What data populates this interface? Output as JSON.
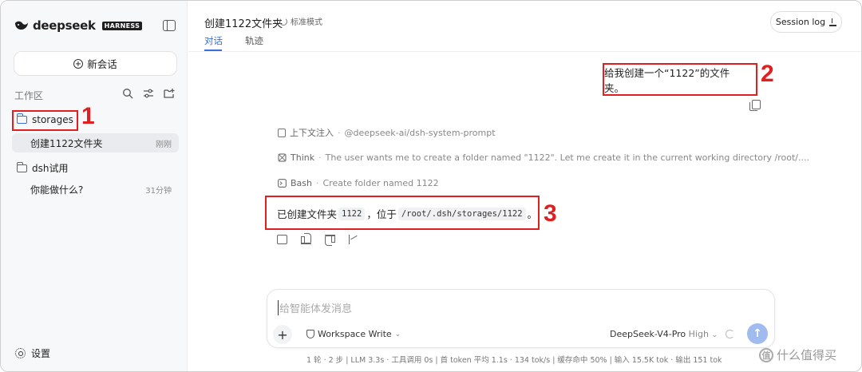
{
  "brand": {
    "name": "deepseek",
    "badge": "HARNESS"
  },
  "sidebar": {
    "new_chat": "新会话",
    "workspace_label": "工作区",
    "folders": [
      {
        "name": "storages",
        "chats": [
          {
            "title": "创建1122文件夹",
            "time": "刚刚"
          }
        ]
      },
      {
        "name": "dsh试用",
        "chats": [
          {
            "title": "你能做什么?",
            "time": "31分钟"
          }
        ]
      }
    ],
    "settings": "设置"
  },
  "header": {
    "title": "创建1122文件夹",
    "mode": "标准模式",
    "tabs": [
      {
        "label": "对话"
      },
      {
        "label": "轨迹"
      }
    ],
    "session_log": "Session log"
  },
  "conversation": {
    "user_message": "给我创建一个“1122”的文件夹。",
    "steps": [
      {
        "label": "上下文注入",
        "detail": "@deepseek-ai/dsh-system-prompt"
      },
      {
        "label": "Think",
        "detail": "The user wants me to create a folder named \"1122\". Let me create it in the current working directory /root/...."
      },
      {
        "label": "Bash",
        "detail": "Create folder named 1122"
      }
    ],
    "result": {
      "prefix": "已创建文件夹",
      "folder_code": "1122",
      "middle": "，位于",
      "path_code": "/root/.dsh/storages/1122",
      "suffix": "。"
    }
  },
  "input": {
    "placeholder": "给智能体发消息",
    "workspace_mode": "Workspace Write",
    "model": "DeepSeek-V4-Pro",
    "level": "High"
  },
  "stats": "1 轮 · 2 步  |  LLM 3.3s · 工具调用 0s  |  首 token 平均 1.1s · 134 tok/s  |  缓存命中 50%  |  输入 15.5K tok · 输出 151 tok",
  "annotations": {
    "n1": "1",
    "n2": "2",
    "n3": "3",
    "color": "#e02020"
  },
  "watermark": {
    "mark": "值",
    "text": "什么值得买"
  },
  "colors": {
    "accent": "#3a6fd8",
    "send_button": "#9fbbef",
    "sidebar_bg": "#f7f8fa"
  }
}
